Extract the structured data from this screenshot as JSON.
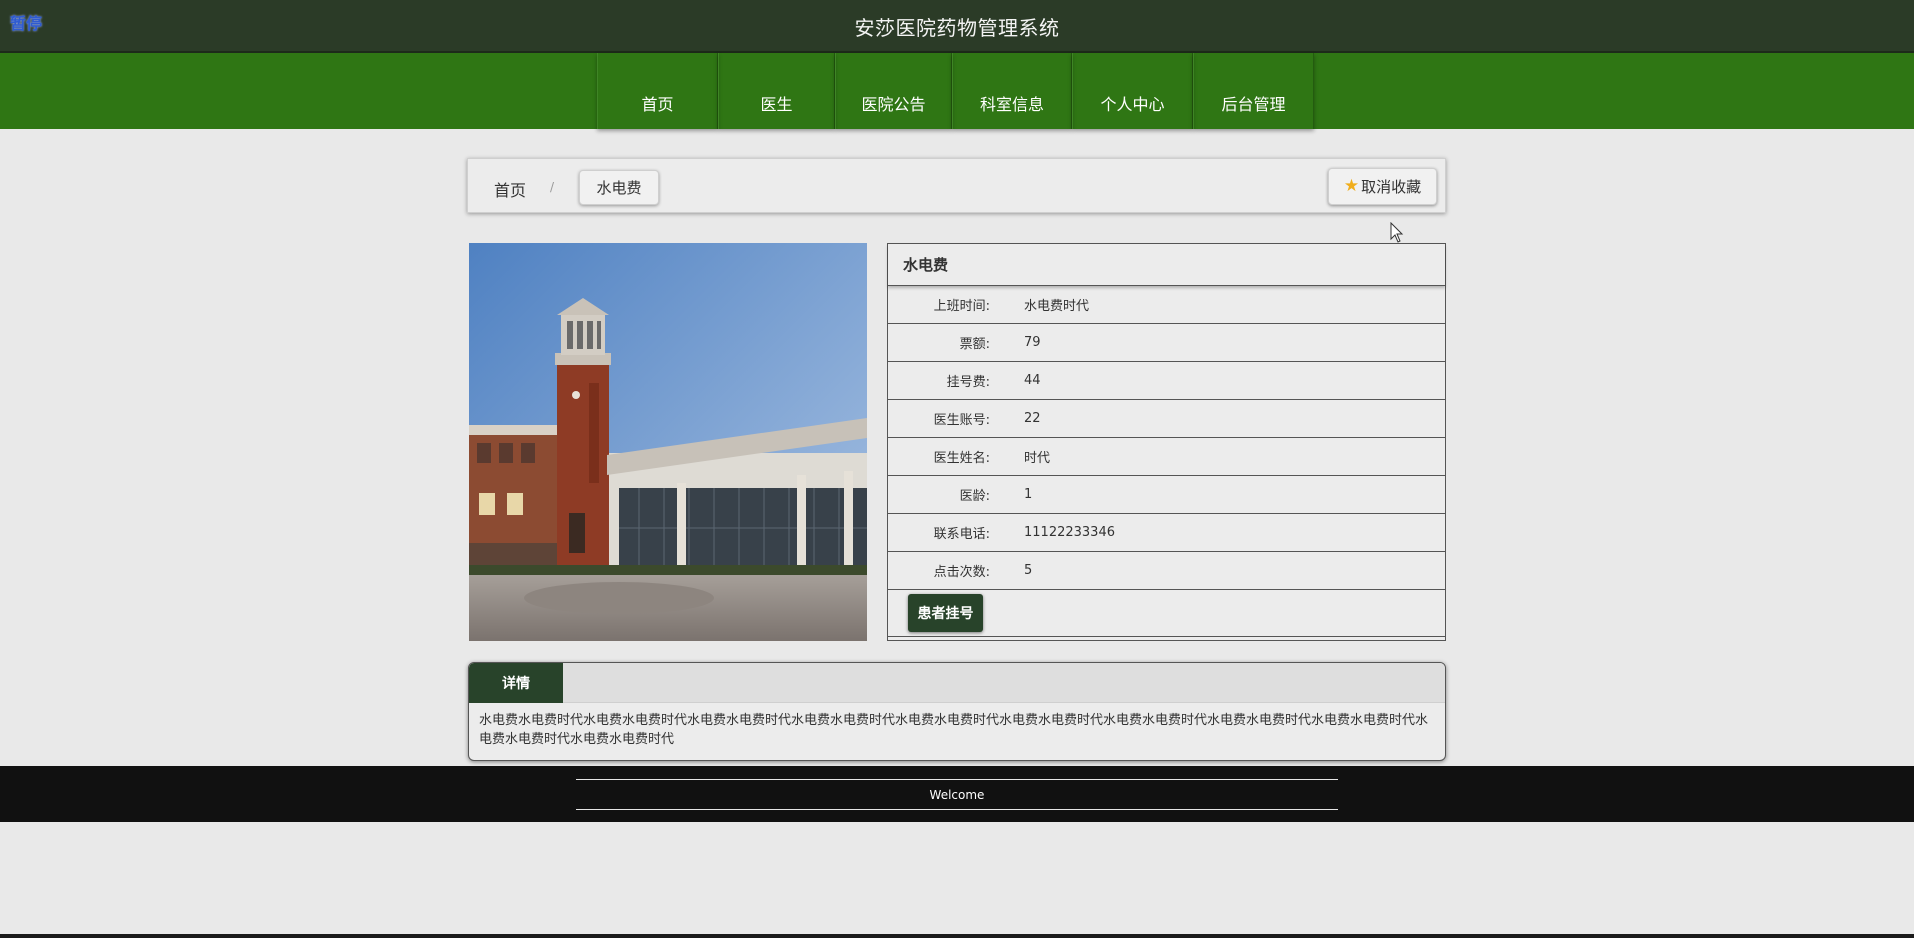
{
  "header": {
    "pause_label": "暂停",
    "site_title": "安莎医院药物管理系统"
  },
  "nav": {
    "items": [
      {
        "label": "首页"
      },
      {
        "label": "医生"
      },
      {
        "label": "医院公告"
      },
      {
        "label": "科室信息"
      },
      {
        "label": "个人中心"
      },
      {
        "label": "后台管理"
      }
    ]
  },
  "breadcrumb": {
    "home": "首页",
    "separator": "/",
    "current": "水电费"
  },
  "favorite_button": {
    "label": "取消收藏",
    "icon": "star-icon"
  },
  "info": {
    "title": "水电费",
    "rows": [
      {
        "label": "上班时间:",
        "value": "水电费时代"
      },
      {
        "label": "票额:",
        "value": "79"
      },
      {
        "label": "挂号费:",
        "value": "44"
      },
      {
        "label": "医生账号:",
        "value": "22"
      },
      {
        "label": "医生姓名:",
        "value": "时代"
      },
      {
        "label": "医龄:",
        "value": "1"
      },
      {
        "label": "联系电话:",
        "value": "11122233346"
      },
      {
        "label": "点击次数:",
        "value": "5"
      }
    ],
    "book_button": "患者挂号"
  },
  "details": {
    "tab_label": "详情",
    "text": "水电费水电费时代水电费水电费时代水电费水电费时代水电费水电费时代水电费水电费时代水电费水电费时代水电费水电费时代水电费水电费时代水电费水电费时代水电费水电费时代水电费水电费时代"
  },
  "footer": {
    "text": "Welcome"
  },
  "colors": {
    "topbar": "#2b3b27",
    "navbar": "#2f7614",
    "accent_dark_green": "#28432a",
    "footer": "#111111",
    "star": "#f0ad1b"
  }
}
